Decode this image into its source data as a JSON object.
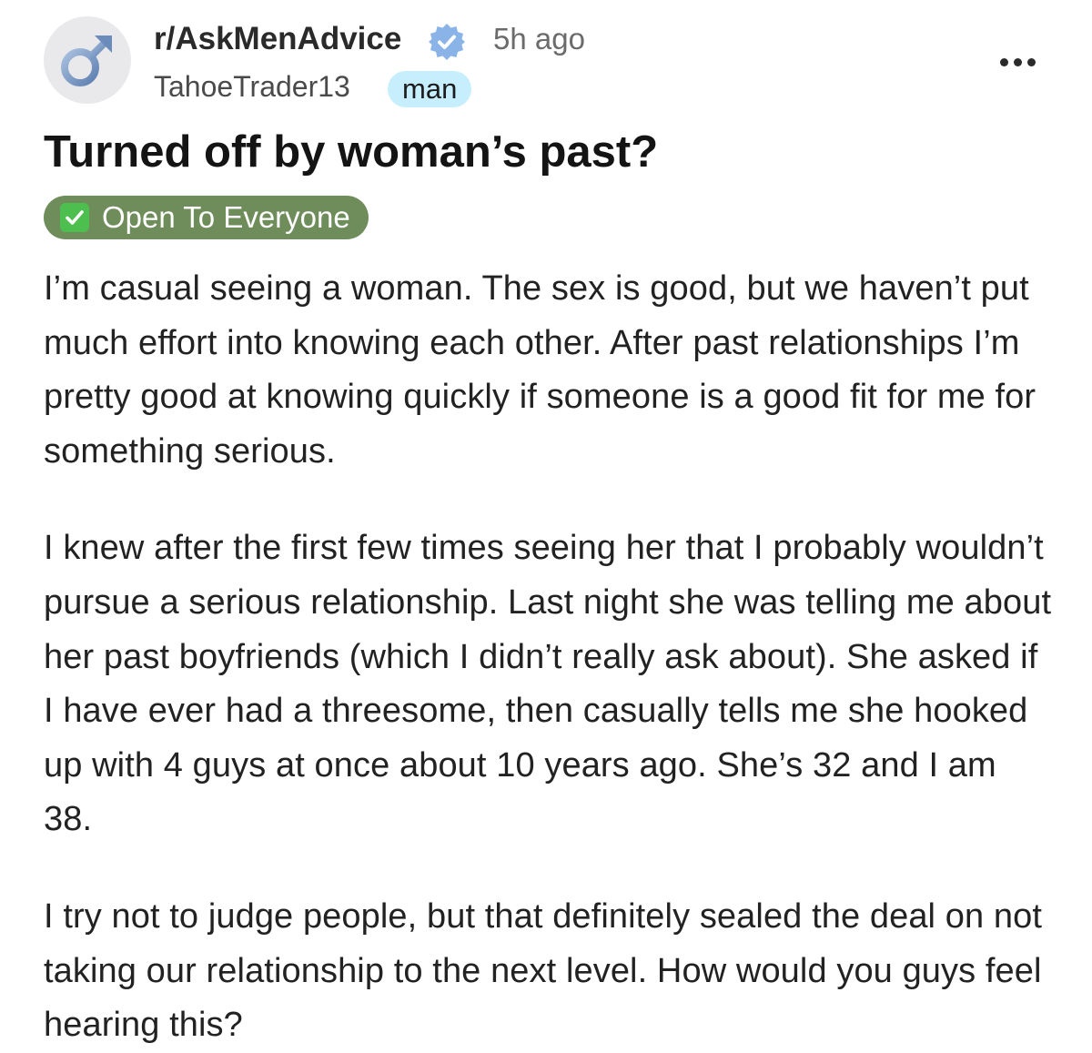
{
  "post": {
    "subreddit": "r/AskMenAdvice",
    "time_ago": "5h ago",
    "username": "TahoeTrader13",
    "user_flair": "man",
    "title": "Turned off by woman’s past?",
    "post_flair": "Open To Everyone",
    "body": [
      "I’m casual seeing a woman. The sex is good, but we haven’t put much effort into knowing each other. After past relationships I’m pretty good at knowing quickly if someone is a good fit for me for something serious.",
      "I knew after the first few times seeing her that I probably wouldn’t pursue a serious relationship. Last night she was telling me about her past boyfriends (which I didn’t really ask about). She asked if I have ever had a threesome, then casually tells me she hooked up with 4 guys at once about 10 years ago. She’s 32 and I am 38.",
      "I try not to judge people, but that definitely sealed the deal on not taking our relationship to the next level. How would you guys feel hearing this?"
    ]
  },
  "icons": {
    "avatar": "male-symbol-icon",
    "verified": "verified-badge-icon",
    "more": "more-options-icon",
    "flair_check": "check-box-icon"
  },
  "colors": {
    "user_flair_bg": "#c7eefc",
    "post_flair_bg": "#6f8d5b",
    "check_green": "#4dbf4f",
    "verified_blue": "#8ab4e8"
  }
}
